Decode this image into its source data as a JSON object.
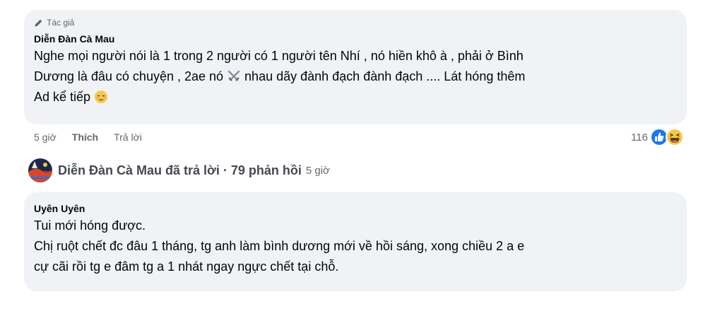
{
  "comment": {
    "badge": "Tác giả",
    "author": "Diễn Đàn Cà Mau",
    "line1": "Nghe mọi người nói là 1 trong 2 người có 1 người tên Nhí , nó hiền khô à , phải ở Bình",
    "line2_before_icon": "Dương là đâu có chuyện , 2ae nó ",
    "line2_after_icon": " nhau dãy đành đạch đành đạch .... Lát hóng thêm",
    "line3": "Ad kể tiếp ",
    "actions": {
      "time": "5 giờ",
      "like": "Thích",
      "reply": "Trả lời"
    },
    "reaction_count": "116"
  },
  "replies_summary": {
    "text": "Diễn Đàn Cà Mau đã trả lời · 79 phản hồi",
    "time": "5 giờ"
  },
  "reply": {
    "author": "Uyên Uyên",
    "line1": "Tui mới hóng được.",
    "line2": "Chị ruột chết đc đâu 1 tháng, tg anh làm bình dương mới về hồi sáng, xong chiều 2 a e",
    "line3": "cự cãi rồi tg e đâm tg a 1 nhát ngay ngực chết tại chỗ."
  },
  "icons": {
    "badge": "pencil-icon",
    "swords": "crossed-swords-icon",
    "emoji": "relieved-face-icon",
    "reactions": [
      "like-icon",
      "haha-icon"
    ],
    "avatar": "page-avatar"
  },
  "colors": {
    "bubble": "#f0f2f5",
    "like_blue": "#1877f2",
    "secondary_text": "#65676b"
  }
}
